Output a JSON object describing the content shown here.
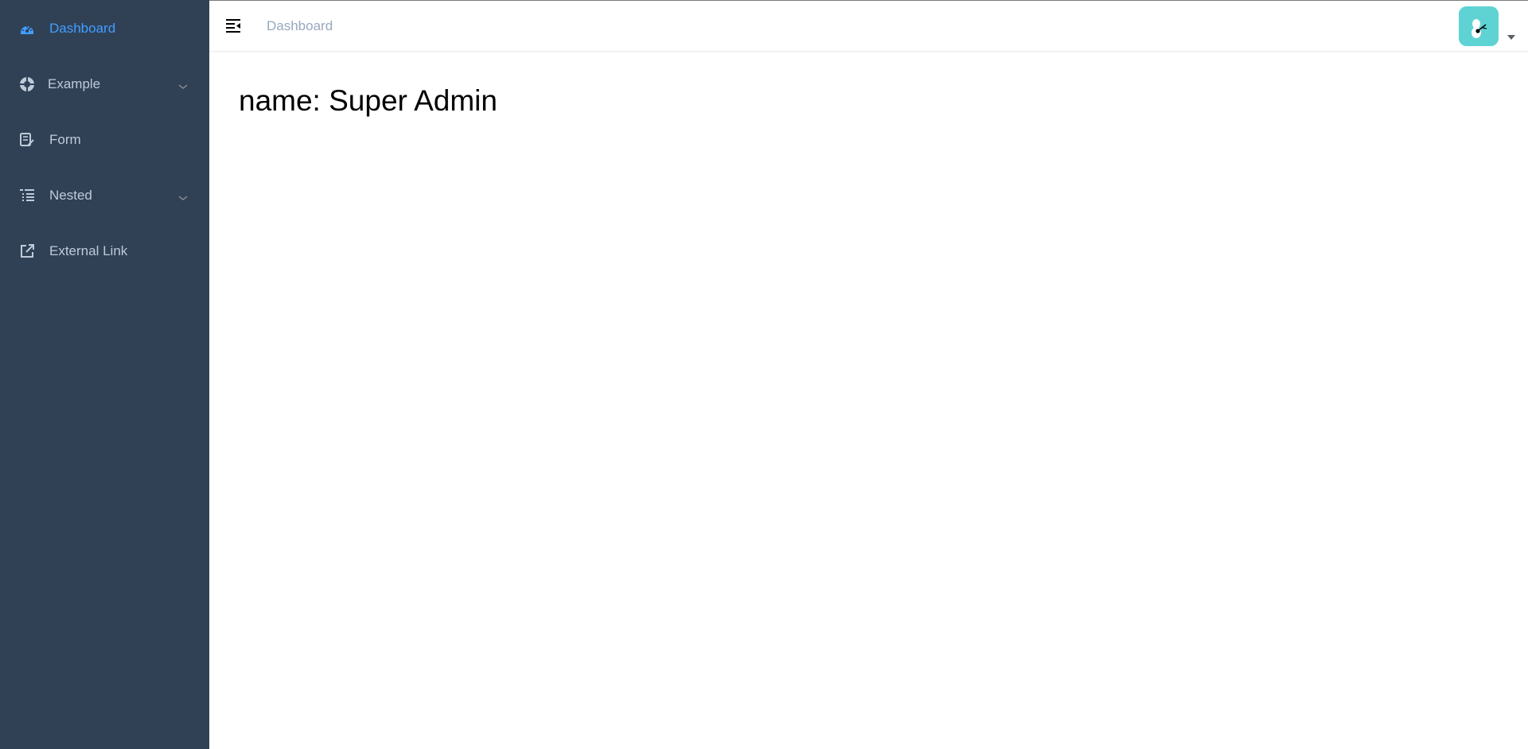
{
  "sidebar": {
    "items": [
      {
        "label": "Dashboard",
        "icon": "dashboard-icon",
        "active": true,
        "has_submenu": false
      },
      {
        "label": "Example",
        "icon": "example-icon",
        "active": false,
        "has_submenu": true
      },
      {
        "label": "Form",
        "icon": "form-icon",
        "active": false,
        "has_submenu": false
      },
      {
        "label": "Nested",
        "icon": "nested-icon",
        "active": false,
        "has_submenu": true
      },
      {
        "label": "External Link",
        "icon": "external-link-icon",
        "active": false,
        "has_submenu": false
      }
    ]
  },
  "navbar": {
    "breadcrumb": "Dashboard",
    "hamburger_icon": "hamburger-icon",
    "avatar_icon": "avatar-icon",
    "caret_icon": "caret-down-icon"
  },
  "main": {
    "dashboard_text": "name: Super Admin"
  },
  "colors": {
    "sidebar_bg": "#304156",
    "menu_text": "#bfcbd9",
    "active_text": "#409eff",
    "breadcrumb_text": "#97a8be",
    "avatar_bg": "#5fd3d3"
  }
}
